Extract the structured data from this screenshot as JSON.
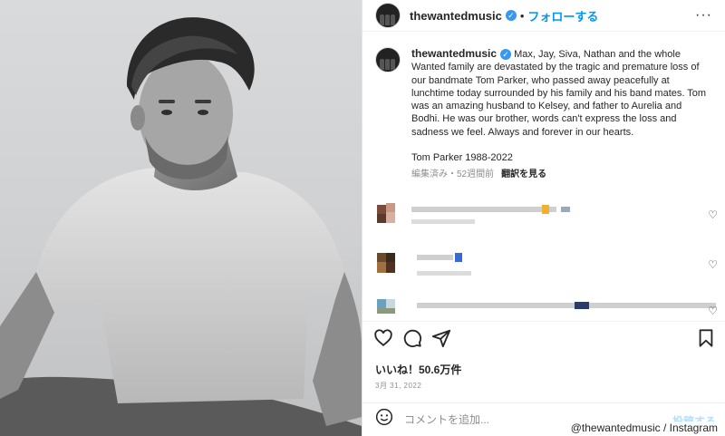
{
  "header": {
    "username": "thewantedmusic",
    "separator": "•",
    "follow_label": "フォローする",
    "more": "···"
  },
  "caption": {
    "username": "thewantedmusic",
    "text": "Max, Jay, Siva, Nathan and the whole Wanted family are devastated by the tragic and premature loss of our bandmate Tom Parker, who passed away peacefully at lunchtime today surrounded by his family and his band mates. Tom was an amazing husband to Kelsey, and father to Aurelia and Bodhi. He was our brother, words can't express the loss and sadness we feel. Always and forever in our hearts.",
    "signature": "Tom Parker 1988-2022",
    "meta": "編集済み・52週間前",
    "translate_label": "翻訳を見る"
  },
  "actions": {
    "like": "heart-icon",
    "comment": "comment-icon",
    "share": "share-icon",
    "save": "bookmark-icon"
  },
  "likes": "いいね！50.6万件",
  "date": "3月 31, 2022",
  "add_comment": {
    "placeholder": "コメントを追加...",
    "post_label": "投稿する"
  },
  "credit": "@thewantedmusic / Instagram",
  "colors": {
    "link": "#0095f6",
    "verified": "#3897f0",
    "muted": "#8e8e8e",
    "text": "#262626"
  }
}
